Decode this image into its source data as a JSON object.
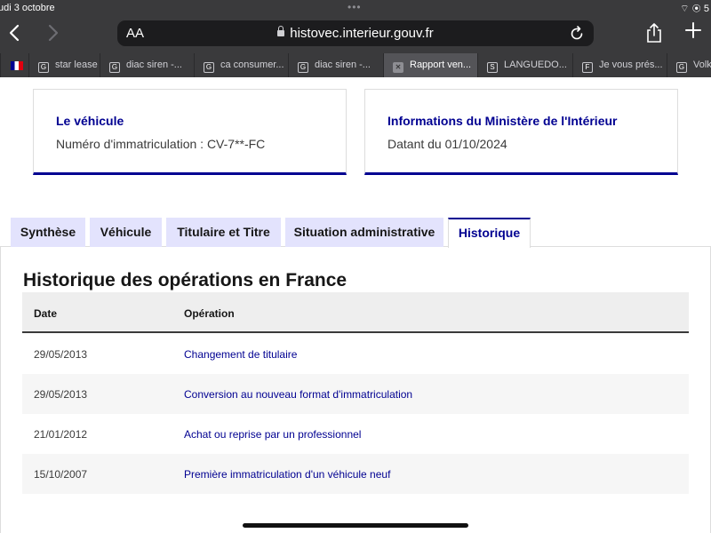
{
  "status_bar": {
    "date": "udi 3 octobre",
    "dots": "•••",
    "right": "⌔ ◉ 5"
  },
  "browser": {
    "back_icon": "chevron-left-icon",
    "forward_icon": "chevron-right-icon",
    "aa_label": "AA",
    "url": "histovec.interieur.gouv.fr",
    "share_icon": "share-icon",
    "new_tab_icon": "plus-icon",
    "tabs": [
      {
        "fav": "G",
        "label": "star lease s"
      },
      {
        "fav": "G",
        "label": "diac siren -..."
      },
      {
        "fav": "G",
        "label": "ca consumer..."
      },
      {
        "fav": "G",
        "label": "diac siren -..."
      },
      {
        "fav": "✕",
        "label": "Rapport ven...",
        "active": true
      },
      {
        "fav": "S",
        "label": "LANGUEDO..."
      },
      {
        "fav": "F",
        "label": "Je vous prés..."
      },
      {
        "fav": "G",
        "label": "Volks"
      }
    ]
  },
  "vehicle_card": {
    "title": "Le véhicule",
    "text": "Numéro d'immatriculation : CV-7**-FC"
  },
  "ministry_card": {
    "title": "Informations du Ministère de l'Intérieur",
    "text": "Datant du 01/10/2024"
  },
  "tabs": [
    {
      "label": "Synthèse"
    },
    {
      "label": "Véhicule"
    },
    {
      "label": "Titulaire et Titre"
    },
    {
      "label": "Situation administrative"
    },
    {
      "label": "Historique",
      "selected": true
    }
  ],
  "history": {
    "title": "Historique des opérations en France",
    "columns": {
      "date": "Date",
      "operation": "Opération"
    },
    "rows": [
      {
        "date": "29/05/2013",
        "operation": "Changement de titulaire"
      },
      {
        "date": "29/05/2013",
        "operation": "Conversion au nouveau format d'immatriculation"
      },
      {
        "date": "21/01/2012",
        "operation": "Achat ou reprise par un professionnel"
      },
      {
        "date": "15/10/2007",
        "operation": "Première immatriculation d'un véhicule neuf"
      }
    ]
  },
  "colors": {
    "accent": "#000091",
    "tab_bg": "#e3e3fd",
    "chrome": "#3a3a3c"
  }
}
